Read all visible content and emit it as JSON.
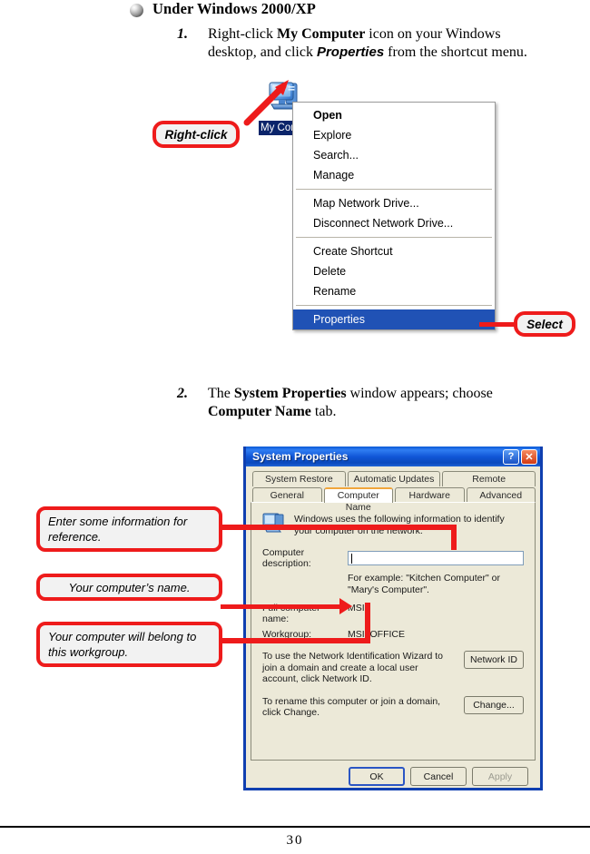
{
  "heading": {
    "bullet_icon": "sphere-bullet-icon",
    "text": "Under Windows 2000/XP"
  },
  "steps": [
    {
      "number": "1.",
      "text_part1": "Right-click ",
      "bold1": "My Computer",
      "text_part2": " icon on your Windows desktop, and click ",
      "bolditalic": "Properties",
      "text_part3": " from the shortcut menu."
    },
    {
      "number": "2.",
      "text_part1": "The ",
      "bold1": "System Properties",
      "text_part2": " window appears; choose ",
      "bold2": "Computer Name",
      "text_part3": " tab."
    }
  ],
  "desktop": {
    "icon_name": "my-computer-icon",
    "icon_label": "My Com"
  },
  "context_menu": {
    "items": [
      {
        "label": "Open",
        "bold": true,
        "selected": false
      },
      {
        "label": "Explore",
        "bold": false,
        "selected": false
      },
      {
        "label": "Search...",
        "bold": false,
        "selected": false
      },
      {
        "label": "Manage",
        "bold": false,
        "selected": false
      },
      {
        "separator": true
      },
      {
        "label": "Map Network Drive...",
        "bold": false,
        "selected": false
      },
      {
        "label": "Disconnect Network Drive...",
        "bold": false,
        "selected": false
      },
      {
        "separator": true
      },
      {
        "label": "Create Shortcut",
        "bold": false,
        "selected": false
      },
      {
        "label": "Delete",
        "bold": false,
        "selected": false
      },
      {
        "label": "Rename",
        "bold": false,
        "selected": false
      },
      {
        "separator": true
      },
      {
        "label": "Properties",
        "bold": false,
        "selected": true
      }
    ]
  },
  "callouts": {
    "right_click": "Right-click",
    "select": "Select",
    "description_note": "Enter some information for reference.",
    "name_note": "Your computer’s name.",
    "workgroup_note": "Your computer will belong to this workgroup."
  },
  "dialog": {
    "title": "System Properties",
    "help_button": "?",
    "close_button": "✕",
    "tabs_row1": [
      "System Restore",
      "Automatic Updates",
      "Remote"
    ],
    "tabs_row2": [
      "General",
      "Computer Name",
      "Hardware",
      "Advanced"
    ],
    "active_tab": "Computer Name",
    "intro_icon": "computer-network-icon",
    "intro_text": "Windows uses the following information to identify your computer on the network.",
    "description_label": "Computer description:",
    "description_value": "",
    "description_hint": "For example: \"Kitchen Computer\" or \"Mary's Computer\".",
    "full_name_label": "Full computer name:",
    "full_name_value": "MSI.",
    "workgroup_label": "Workgroup:",
    "workgroup_value": "MSI_OFFICE",
    "network_id_text": "To use the Network Identification Wizard to join a domain and create a local user account, click Network ID.",
    "network_id_button": "Network ID",
    "change_text": "To rename this computer or join a domain, click Change.",
    "change_button": "Change...",
    "ok_button": "OK",
    "cancel_button": "Cancel",
    "apply_button": "Apply"
  },
  "footer": {
    "page_number": "30"
  },
  "colors": {
    "callout_red": "#ee1b1b",
    "menu_highlight": "#2052b5",
    "titlebar_blue": "#0f3fb0",
    "dialog_face": "#ece9d8",
    "active_tab_accent": "#f0a63c"
  }
}
